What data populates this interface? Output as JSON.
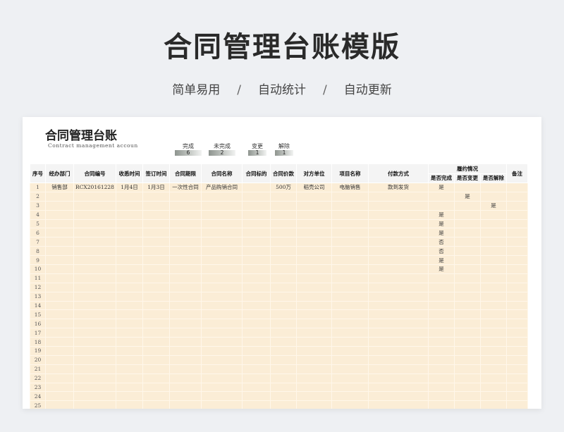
{
  "hero": {
    "title": "合同管理台账模版",
    "sub": [
      "简单易用",
      "/",
      "自动统计",
      "/",
      "自动更新"
    ]
  },
  "sheet": {
    "title": "合同管理台账",
    "subtitle_en": "Contract management accoun",
    "stats": [
      {
        "label": "完成",
        "value": "6"
      },
      {
        "label": "未完成",
        "value": "2"
      },
      {
        "label": "变更",
        "value": "1"
      },
      {
        "label": "解除",
        "value": "1"
      }
    ],
    "columns": [
      "序号",
      "经办部门",
      "合同编号",
      "收悉时间",
      "签订时间",
      "合同期限",
      "合同名称",
      "合同标的",
      "合同价款",
      "对方单位",
      "项目名称",
      "付款方式"
    ],
    "performance_group": "履约情况",
    "performance_cols": [
      "是否完成",
      "是否变更",
      "是否解除"
    ],
    "remark_col": "备注",
    "rows": [
      {
        "n": "1",
        "dept": "销售部",
        "code": "RCX20161228",
        "recv": "1月4日",
        "sign": "1月3日",
        "term": "一次性合同",
        "name": "产品购销合同",
        "target": "",
        "price": "500万",
        "party": "稻壳公司",
        "project": "电脑销售",
        "pay": "款到发货",
        "done": "是",
        "changed": "",
        "cancel": "",
        "remark": ""
      },
      {
        "n": "2",
        "dept": "",
        "code": "",
        "recv": "",
        "sign": "",
        "term": "",
        "name": "",
        "target": "",
        "price": "",
        "party": "",
        "project": "",
        "pay": "",
        "done": "",
        "changed": "是",
        "cancel": "",
        "remark": ""
      },
      {
        "n": "3",
        "dept": "",
        "code": "",
        "recv": "",
        "sign": "",
        "term": "",
        "name": "",
        "target": "",
        "price": "",
        "party": "",
        "project": "",
        "pay": "",
        "done": "",
        "changed": "",
        "cancel": "是",
        "remark": ""
      },
      {
        "n": "4",
        "dept": "",
        "code": "",
        "recv": "",
        "sign": "",
        "term": "",
        "name": "",
        "target": "",
        "price": "",
        "party": "",
        "project": "",
        "pay": "",
        "done": "是",
        "changed": "",
        "cancel": "",
        "remark": ""
      },
      {
        "n": "5",
        "dept": "",
        "code": "",
        "recv": "",
        "sign": "",
        "term": "",
        "name": "",
        "target": "",
        "price": "",
        "party": "",
        "project": "",
        "pay": "",
        "done": "是",
        "changed": "",
        "cancel": "",
        "remark": ""
      },
      {
        "n": "6",
        "dept": "",
        "code": "",
        "recv": "",
        "sign": "",
        "term": "",
        "name": "",
        "target": "",
        "price": "",
        "party": "",
        "project": "",
        "pay": "",
        "done": "是",
        "changed": "",
        "cancel": "",
        "remark": ""
      },
      {
        "n": "7",
        "dept": "",
        "code": "",
        "recv": "",
        "sign": "",
        "term": "",
        "name": "",
        "target": "",
        "price": "",
        "party": "",
        "project": "",
        "pay": "",
        "done": "否",
        "changed": "",
        "cancel": "",
        "remark": ""
      },
      {
        "n": "8",
        "dept": "",
        "code": "",
        "recv": "",
        "sign": "",
        "term": "",
        "name": "",
        "target": "",
        "price": "",
        "party": "",
        "project": "",
        "pay": "",
        "done": "否",
        "changed": "",
        "cancel": "",
        "remark": ""
      },
      {
        "n": "9",
        "dept": "",
        "code": "",
        "recv": "",
        "sign": "",
        "term": "",
        "name": "",
        "target": "",
        "price": "",
        "party": "",
        "project": "",
        "pay": "",
        "done": "是",
        "changed": "",
        "cancel": "",
        "remark": ""
      },
      {
        "n": "10",
        "dept": "",
        "code": "",
        "recv": "",
        "sign": "",
        "term": "",
        "name": "",
        "target": "",
        "price": "",
        "party": "",
        "project": "",
        "pay": "",
        "done": "是",
        "changed": "",
        "cancel": "",
        "remark": ""
      },
      {
        "n": "11",
        "dept": "",
        "code": "",
        "recv": "",
        "sign": "",
        "term": "",
        "name": "",
        "target": "",
        "price": "",
        "party": "",
        "project": "",
        "pay": "",
        "done": "",
        "changed": "",
        "cancel": "",
        "remark": ""
      },
      {
        "n": "12",
        "dept": "",
        "code": "",
        "recv": "",
        "sign": "",
        "term": "",
        "name": "",
        "target": "",
        "price": "",
        "party": "",
        "project": "",
        "pay": "",
        "done": "",
        "changed": "",
        "cancel": "",
        "remark": ""
      },
      {
        "n": "13",
        "dept": "",
        "code": "",
        "recv": "",
        "sign": "",
        "term": "",
        "name": "",
        "target": "",
        "price": "",
        "party": "",
        "project": "",
        "pay": "",
        "done": "",
        "changed": "",
        "cancel": "",
        "remark": ""
      },
      {
        "n": "14",
        "dept": "",
        "code": "",
        "recv": "",
        "sign": "",
        "term": "",
        "name": "",
        "target": "",
        "price": "",
        "party": "",
        "project": "",
        "pay": "",
        "done": "",
        "changed": "",
        "cancel": "",
        "remark": ""
      },
      {
        "n": "15",
        "dept": "",
        "code": "",
        "recv": "",
        "sign": "",
        "term": "",
        "name": "",
        "target": "",
        "price": "",
        "party": "",
        "project": "",
        "pay": "",
        "done": "",
        "changed": "",
        "cancel": "",
        "remark": ""
      },
      {
        "n": "16",
        "dept": "",
        "code": "",
        "recv": "",
        "sign": "",
        "term": "",
        "name": "",
        "target": "",
        "price": "",
        "party": "",
        "project": "",
        "pay": "",
        "done": "",
        "changed": "",
        "cancel": "",
        "remark": ""
      },
      {
        "n": "17",
        "dept": "",
        "code": "",
        "recv": "",
        "sign": "",
        "term": "",
        "name": "",
        "target": "",
        "price": "",
        "party": "",
        "project": "",
        "pay": "",
        "done": "",
        "changed": "",
        "cancel": "",
        "remark": ""
      },
      {
        "n": "18",
        "dept": "",
        "code": "",
        "recv": "",
        "sign": "",
        "term": "",
        "name": "",
        "target": "",
        "price": "",
        "party": "",
        "project": "",
        "pay": "",
        "done": "",
        "changed": "",
        "cancel": "",
        "remark": ""
      },
      {
        "n": "19",
        "dept": "",
        "code": "",
        "recv": "",
        "sign": "",
        "term": "",
        "name": "",
        "target": "",
        "price": "",
        "party": "",
        "project": "",
        "pay": "",
        "done": "",
        "changed": "",
        "cancel": "",
        "remark": ""
      },
      {
        "n": "20",
        "dept": "",
        "code": "",
        "recv": "",
        "sign": "",
        "term": "",
        "name": "",
        "target": "",
        "price": "",
        "party": "",
        "project": "",
        "pay": "",
        "done": "",
        "changed": "",
        "cancel": "",
        "remark": ""
      },
      {
        "n": "21",
        "dept": "",
        "code": "",
        "recv": "",
        "sign": "",
        "term": "",
        "name": "",
        "target": "",
        "price": "",
        "party": "",
        "project": "",
        "pay": "",
        "done": "",
        "changed": "",
        "cancel": "",
        "remark": ""
      },
      {
        "n": "22",
        "dept": "",
        "code": "",
        "recv": "",
        "sign": "",
        "term": "",
        "name": "",
        "target": "",
        "price": "",
        "party": "",
        "project": "",
        "pay": "",
        "done": "",
        "changed": "",
        "cancel": "",
        "remark": ""
      },
      {
        "n": "23",
        "dept": "",
        "code": "",
        "recv": "",
        "sign": "",
        "term": "",
        "name": "",
        "target": "",
        "price": "",
        "party": "",
        "project": "",
        "pay": "",
        "done": "",
        "changed": "",
        "cancel": "",
        "remark": ""
      },
      {
        "n": "24",
        "dept": "",
        "code": "",
        "recv": "",
        "sign": "",
        "term": "",
        "name": "",
        "target": "",
        "price": "",
        "party": "",
        "project": "",
        "pay": "",
        "done": "",
        "changed": "",
        "cancel": "",
        "remark": ""
      },
      {
        "n": "25",
        "dept": "",
        "code": "",
        "recv": "",
        "sign": "",
        "term": "",
        "name": "",
        "target": "",
        "price": "",
        "party": "",
        "project": "",
        "pay": "",
        "done": "",
        "changed": "",
        "cancel": "",
        "remark": ""
      }
    ]
  }
}
